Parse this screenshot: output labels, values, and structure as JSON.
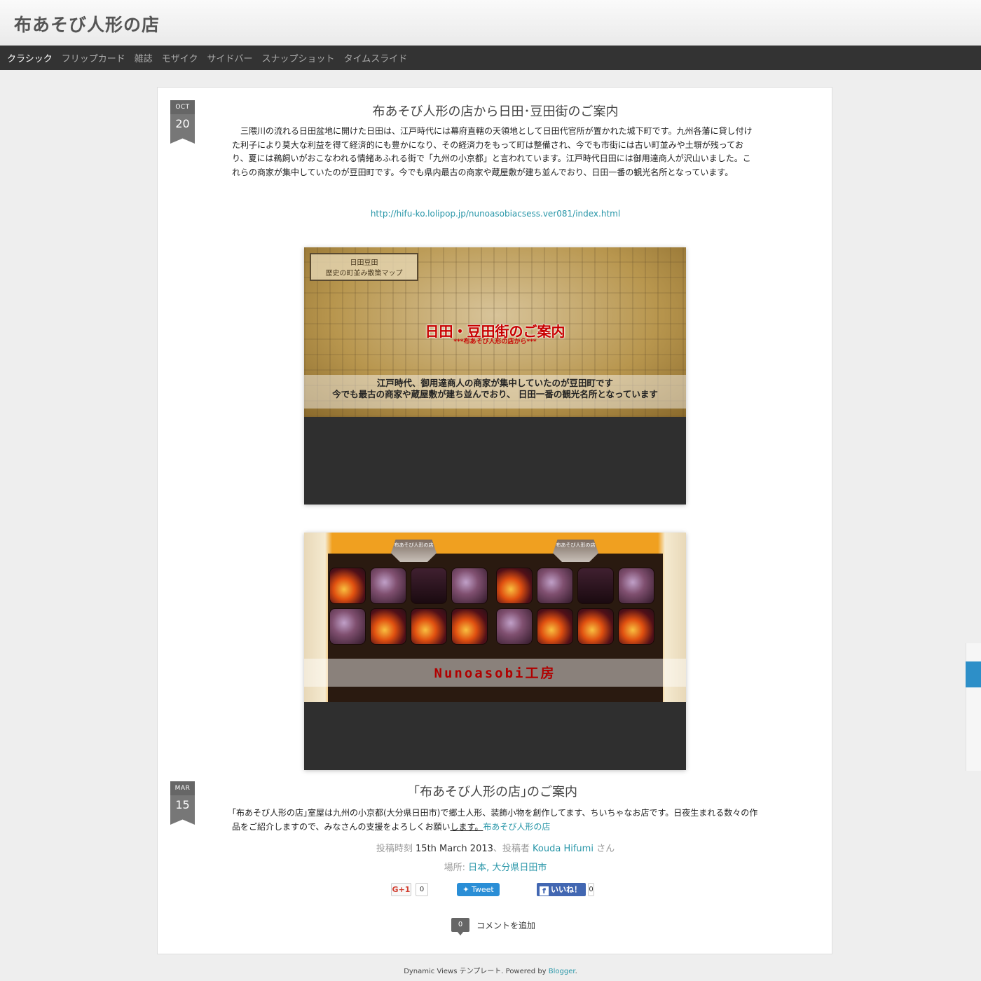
{
  "site": {
    "title": "布あそび人形の店"
  },
  "nav": {
    "items": [
      {
        "label": "クラシック",
        "active": true
      },
      {
        "label": "フリップカード",
        "active": false
      },
      {
        "label": "雑誌",
        "active": false
      },
      {
        "label": "モザイク",
        "active": false
      },
      {
        "label": "サイドバー",
        "active": false
      },
      {
        "label": "スナップショット",
        "active": false
      },
      {
        "label": "タイムスライド",
        "active": false
      }
    ]
  },
  "posts": [
    {
      "date": {
        "month": "OCT",
        "day": "20"
      },
      "title": "布あそび人形の店から日田･豆田街のご案内",
      "body": "　三隈川の流れる日田盆地に開けた日田は、江戸時代には幕府直轄の天領地として日田代官所が置かれた城下町です。九州各藩に貸し付けた利子により莫大な利益を得て経済的にも豊かになり、その経済力をもって町は整備され、今でも市街には古い町並みや土塀が残っており、夏には鵜飼いがおこなわれる情緒あふれる街で「九州の小京都」と言われています。江戸時代日田には御用達商人が沢山いました。これらの商家が集中していたのが豆田町です。今でも県内最古の商家や蔵屋敷が建ち並んでおり、日田一番の観光名所となっています。",
      "link": "http://hifu-ko.lolipop.jp/nunoasobiacsess.ver081/index.html",
      "image1": {
        "legend_line1": "日田豆田",
        "legend_line2": "歴史の町並み散策マップ",
        "headline": "日田・豆田街のご案内",
        "subline": "***布あそび人形の店から***",
        "caption_line1": "江戸時代、御用達商人の商家が集中していたのが豆田町です",
        "caption_line2": "今でも最古の商家や蔵屋敷が建ち並んでおり、 日田一番の観光名所となっています"
      },
      "image2": {
        "sign_left": "布あそび人形の店",
        "sign_right": "布あそび人形の店",
        "headline": "Nunoasobi工房"
      }
    },
    {
      "date": {
        "month": "MAR",
        "day": "15"
      },
      "title": "｢布あそび人形の店｣のご案内",
      "body_prefix": "｢布あそび人形の店｣室屋は九州の小京都(大分県日田市)で郷土人形、装飾小物を創作してます、ちいちゃなお店です。日夜生まれる数々の作品をご紹介しますので、みなさんの支援をよろしくお願い",
      "body_underlined": "します。",
      "body_link": "布あそび人形の店",
      "meta": {
        "posted_label": "投稿時刻",
        "posted_date": "15th March 2013",
        "author_label": "、投稿者",
        "author": "Kouda Hifumi",
        "author_suffix": "さん",
        "location_label": "場所:",
        "location": "日本, 大分県日田市"
      },
      "share": {
        "gplus_label": "G+1",
        "gplus_count": "0",
        "tweet_label": "Tweet",
        "fb_label": "いいね！",
        "fb_count": "0"
      },
      "comments": {
        "count": "0",
        "label": "コメントを追加"
      }
    }
  ],
  "footer": {
    "prefix": "Dynamic Views テンプレート. Powered by ",
    "link": "Blogger",
    "suffix": "."
  },
  "colors": {
    "nav_bg": "#333333",
    "link": "#2896a8",
    "badge": "#777777",
    "side_tab": "#2d8fc8"
  }
}
